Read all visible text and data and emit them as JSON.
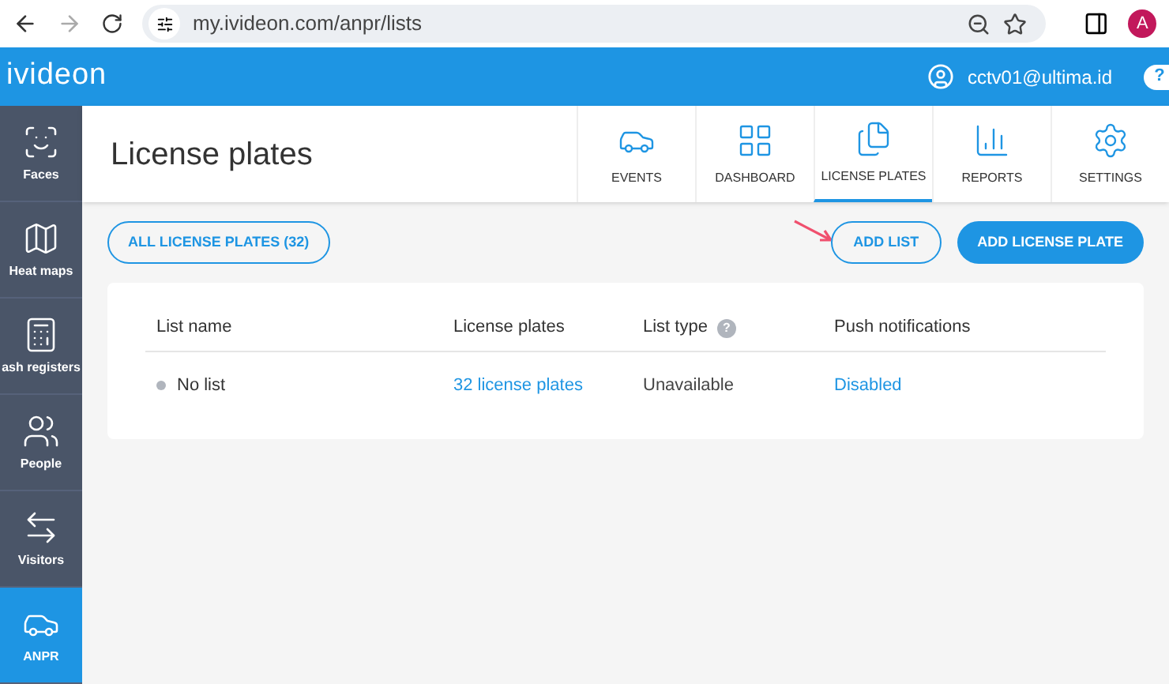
{
  "browser": {
    "url": "my.ivideon.com/anpr/lists",
    "profile_initial": "A",
    "forward_disabled": true
  },
  "header": {
    "logo": "ivideon",
    "user": "cctv01@ultima.id",
    "help": "?"
  },
  "sidebar": {
    "items": [
      {
        "label": "Faces",
        "kind": "faces",
        "selected": false
      },
      {
        "label": "Heat maps",
        "kind": "heatmap",
        "selected": false
      },
      {
        "label": "ash registers",
        "kind": "register",
        "selected": false
      },
      {
        "label": "People",
        "kind": "people",
        "selected": false
      },
      {
        "label": "Visitors",
        "kind": "visitors",
        "selected": false
      },
      {
        "label": "ANPR",
        "kind": "car",
        "selected": true
      }
    ]
  },
  "page": {
    "title": "License plates",
    "tabs": [
      {
        "label": "EVENTS",
        "kind": "car",
        "selected": false
      },
      {
        "label": "DASHBOARD",
        "kind": "grid",
        "selected": false
      },
      {
        "label": "LICENSE PLATES",
        "kind": "docs",
        "selected": true
      },
      {
        "label": "REPORTS",
        "kind": "chart",
        "selected": false
      },
      {
        "label": "SETTINGS",
        "kind": "gear",
        "selected": false
      }
    ]
  },
  "toolbar": {
    "filter_button": "ALL LICENSE PLATES (32)",
    "add_list_button": "ADD LIST",
    "add_plate_button": "ADD LICENSE PLATE"
  },
  "table": {
    "columns": [
      "List name",
      "License plates",
      "List type",
      "Push notifications"
    ],
    "help": "?",
    "rows": [
      {
        "name": "No list",
        "plates": "32 license plates",
        "type": "Unavailable",
        "push": "Disabled"
      }
    ]
  }
}
